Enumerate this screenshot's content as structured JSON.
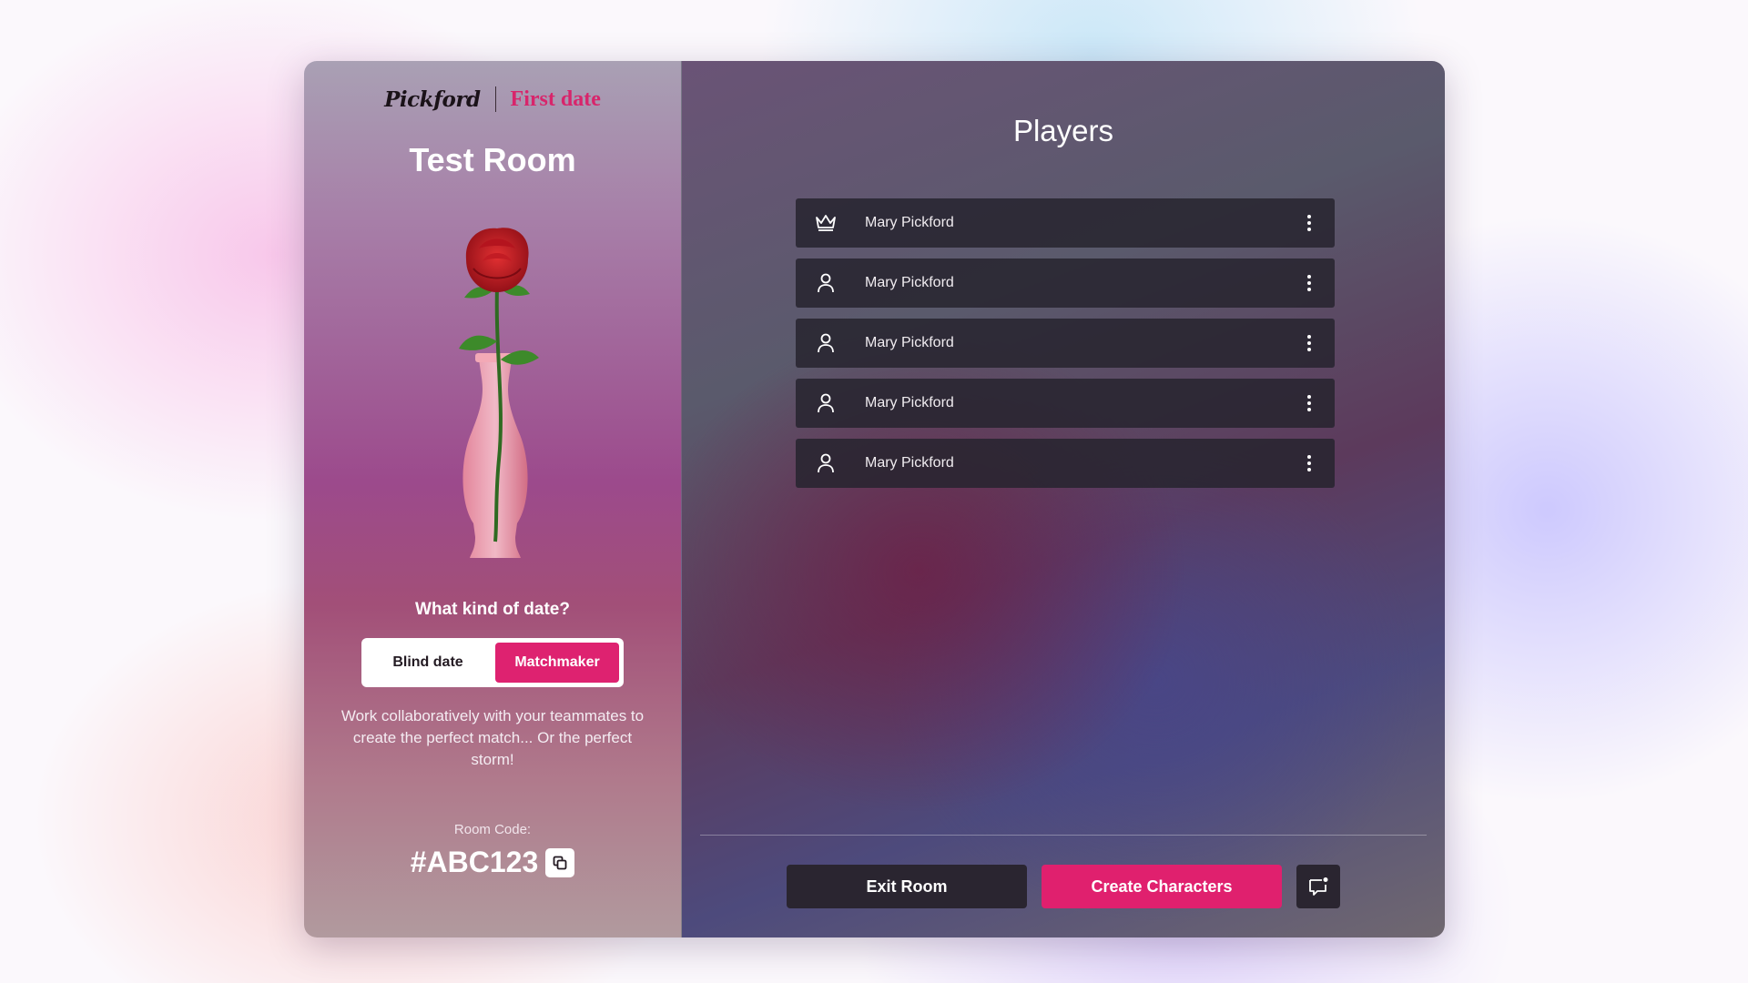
{
  "brand": {
    "logo": "Pickford",
    "subtitle": "First date"
  },
  "room": {
    "title": "Test Room",
    "question": "What kind of date?",
    "options": [
      "Blind date",
      "Matchmaker"
    ],
    "selected_option": "Matchmaker",
    "description": "Work collaboratively with your teammates to create the perfect match... Or the perfect storm!",
    "code_label": "Room Code:",
    "code": "#ABC123"
  },
  "players": {
    "title": "Players",
    "items": [
      {
        "name": "Mary Pickford",
        "role": "host",
        "icon": "crown-icon"
      },
      {
        "name": "Mary Pickford",
        "role": "player",
        "icon": "user-icon"
      },
      {
        "name": "Mary Pickford",
        "role": "player",
        "icon": "user-icon"
      },
      {
        "name": "Mary Pickford",
        "role": "player",
        "icon": "user-icon"
      },
      {
        "name": "Mary Pickford",
        "role": "player",
        "icon": "user-icon"
      }
    ]
  },
  "actions": {
    "exit_label": "Exit Room",
    "create_label": "Create Characters"
  },
  "colors": {
    "accent": "#de2270",
    "dark": "#2a2530"
  }
}
